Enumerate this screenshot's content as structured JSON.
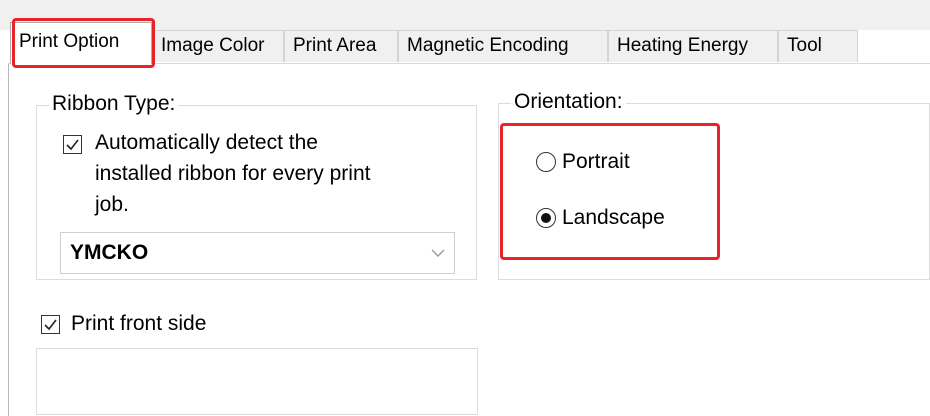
{
  "tabs": [
    {
      "label": "Print Option",
      "active": true
    },
    {
      "label": "Image Color",
      "active": false
    },
    {
      "label": "Print Area",
      "active": false
    },
    {
      "label": "Magnetic Encoding",
      "active": false
    },
    {
      "label": "Heating Energy",
      "active": false
    },
    {
      "label": "Tool",
      "active": false
    }
  ],
  "ribbon_type": {
    "title": "Ribbon Type:",
    "auto_detect": {
      "checked": true,
      "lines": [
        "Automatically detect the",
        "installed ribbon for every print",
        "job."
      ]
    },
    "selected": "YMCKO"
  },
  "orientation": {
    "title": "Orientation:",
    "options": [
      {
        "label": "Portrait",
        "selected": false
      },
      {
        "label": "Landscape",
        "selected": true
      }
    ]
  },
  "print_front_side": {
    "label": "Print front side",
    "checked": true
  },
  "colors": {
    "highlight": "#e8242b",
    "tab_bg": "#f0f0f0",
    "border": "#dcdcdc"
  },
  "icons": {
    "check": "check-icon",
    "dropdown": "chevron-down-icon",
    "radio_on": "radio-selected-icon",
    "radio_off": "radio-empty-icon"
  }
}
